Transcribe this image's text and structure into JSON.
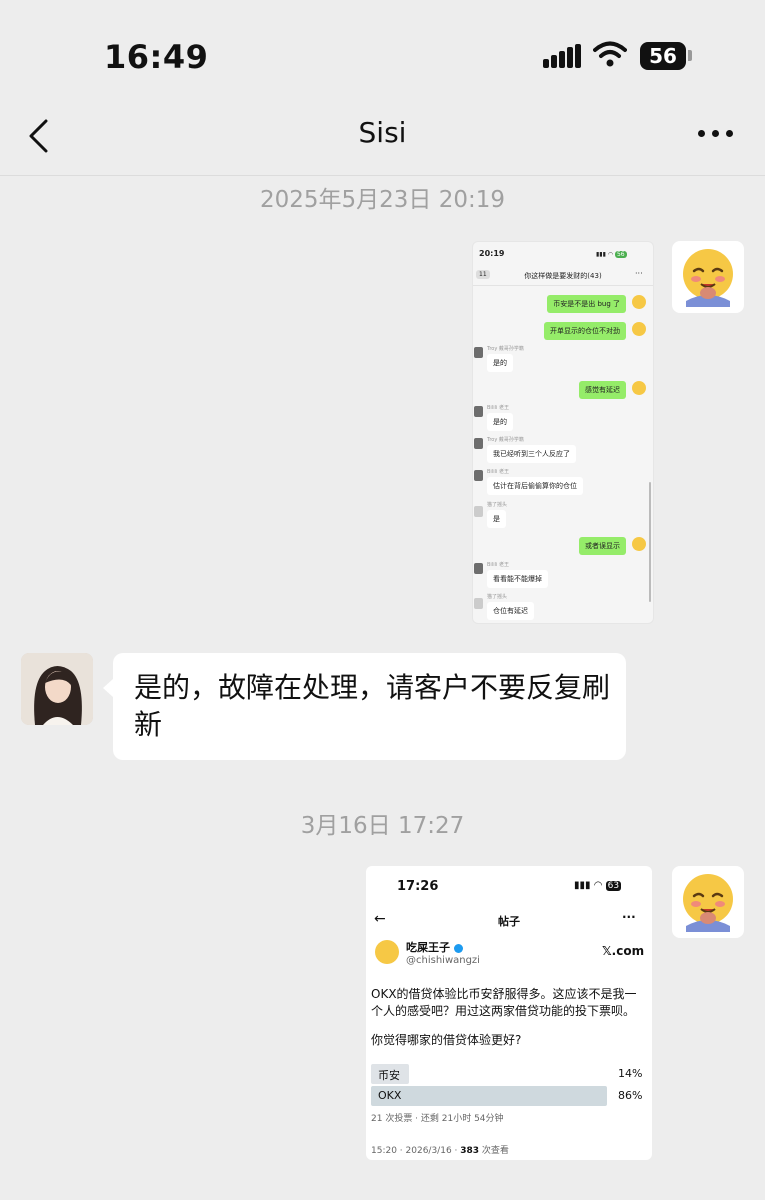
{
  "status_bar": {
    "time": "16:49",
    "battery": "56"
  },
  "header": {
    "title": "Sisi"
  },
  "messages": {
    "ts1": "2025年5月23日 20:19",
    "ts2": "3月16日 17:27",
    "reply": "是的，故障在处理，请客户不要反复刷新"
  },
  "shot1": {
    "time": "20:19",
    "group_badge": "11",
    "group_title": "你这样做是要发财的(43)",
    "msgs": [
      {
        "text": "币安是不是出 bug 了"
      },
      {
        "text": "开单显示的仓位不对劲"
      },
      {
        "name": "Troy 戴哥孙学籍",
        "text": "是的"
      },
      {
        "text": "感觉有延迟"
      },
      {
        "name": "Bilili 老王",
        "text": "是的"
      },
      {
        "name": "Troy 戴哥孙学籍",
        "text": "我已经听到三个人反应了"
      },
      {
        "name": "Bilili 老王",
        "text": "估计在背后偷偷算你的仓位"
      },
      {
        "name": "猫了摇头",
        "text": "是"
      },
      {
        "text": "或者误显示"
      },
      {
        "name": "Bilili 老王",
        "text": "看看能不能爆掉"
      },
      {
        "name": "猫了摇头",
        "text": "仓位有延迟"
      }
    ]
  },
  "shot2": {
    "time": "17:26",
    "battery": "63",
    "page_title": "帖子",
    "author": "吃屎王子",
    "handle": "@chishiwangzi",
    "xcom": "𝕏.com",
    "body1": "OKX的借贷体验比币安舒服得多。这应该不是我一个人的感受吧？用过这两家借贷功能的投下票呗。",
    "body2": "你觉得哪家的借贷体验更好?",
    "poll": [
      {
        "label": "币安",
        "pct": "14%",
        "value": 14
      },
      {
        "label": "OKX",
        "pct": "86%",
        "value": 86
      }
    ],
    "poll_meta": "21 次投票 · 还剩 21小时 54分钟",
    "footer_time": "15:20 · 2026/3/16 · ",
    "views": "383",
    "views_label": " 次查看"
  },
  "colors": {
    "bg": "#ededed",
    "green_bubble": "#95ec69",
    "timestamp": "#a0a0a0"
  },
  "icons": [
    "back-arrow-icon",
    "more-icon",
    "signal-icon",
    "wifi-icon",
    "battery-icon",
    "verified-icon",
    "emoji-avatar-icon"
  ]
}
